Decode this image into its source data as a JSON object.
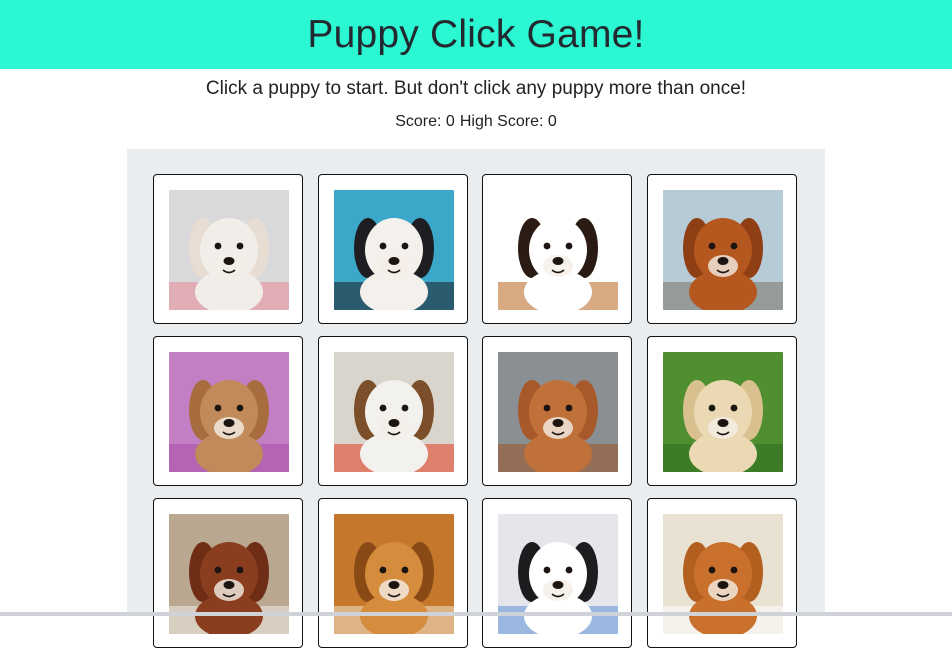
{
  "header": {
    "title": "Puppy Click Game!"
  },
  "instructions": "Click a puppy to start. But don't click any puppy more than once!",
  "score": {
    "label": "Score: 0",
    "high_label": "High Score: 0"
  },
  "colors": {
    "header_bg": "#2cf7d3",
    "board_bg": "#eaedf0"
  },
  "puppies": [
    {
      "icon": "yawning-pitbull-puppy-icon",
      "bg": "#d9d9dc",
      "fur": "#f1ede8",
      "ear": "#e8ddd3",
      "accent": "#e98a95"
    },
    {
      "icon": "french-bulldog-puppy-icon",
      "bg": "#3ba7c9",
      "fur": "#f4f1ec",
      "ear": "#1e1e22",
      "accent": "#1e1e22"
    },
    {
      "icon": "bernese-puppy-icon",
      "bg": "#ffffff",
      "fur": "#ffffff",
      "ear": "#2a1c14",
      "accent": "#b8641f"
    },
    {
      "icon": "cocker-spaniel-puppy-icon",
      "bg": "#b6cbd6",
      "fur": "#b5581f",
      "ear": "#8e3f14",
      "accent": "#7a7466"
    },
    {
      "icon": "pitbull-puppy-on-blanket-icon",
      "bg": "#c37fc3",
      "fur": "#c08a5b",
      "ear": "#a86d3e",
      "accent": "#a84fa5"
    },
    {
      "icon": "beagle-puppy-icon",
      "bg": "#d9d4cc",
      "fur": "#f3f1ee",
      "ear": "#7a4f29",
      "accent": "#e13a1e"
    },
    {
      "icon": "vizsla-puppy-icon",
      "bg": "#8a8f93",
      "fur": "#c0713a",
      "ear": "#a8592a",
      "accent": "#9c5224"
    },
    {
      "icon": "labrador-puppy-in-grass-icon",
      "bg": "#4f8f2f",
      "fur": "#ead9b3",
      "ear": "#d8c08f",
      "accent": "#2f6e1f"
    },
    {
      "icon": "basset-hound-puppy-icon",
      "bg": "#b9a78f",
      "fur": "#8a3d1f",
      "ear": "#6e2d14",
      "accent": "#f3efe9"
    },
    {
      "icon": "sheltie-puppy-icon",
      "bg": "#c5772c",
      "fur": "#d58c3c",
      "ear": "#8a4a16",
      "accent": "#f2e6d2"
    },
    {
      "icon": "dalmatian-puppy-icon",
      "bg": "#e4e6ec",
      "fur": "#ffffff",
      "ear": "#1d1d1f",
      "accent": "#5b8fd6"
    },
    {
      "icon": "corgi-puppy-icon",
      "bg": "#e9e2d3",
      "fur": "#c8702c",
      "ear": "#b25f20",
      "accent": "#ffffff"
    }
  ]
}
